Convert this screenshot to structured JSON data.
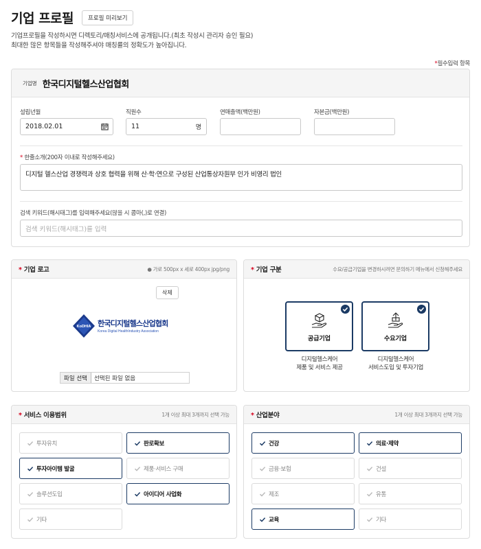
{
  "header": {
    "title": "기업 프로필",
    "preview_button": "프로필 미리보기"
  },
  "description": {
    "line1": "기업프로필을 작성하시면 디렉토리/매칭서비스에 공개됩니다.(최초 작성시 관리자 승인 필요)",
    "line2": "최대한 많은 항목들을 작성해주셔야 매칭률의 정확도가 높아집니다."
  },
  "required_note": "필수입력 항목",
  "profile": {
    "company_label": "기업명",
    "company_name": "한국디지털헬스산업협회",
    "fields": {
      "founded": {
        "label": "설립년월",
        "value": "2018.02.01"
      },
      "employees": {
        "label": "직원수",
        "value": "11",
        "unit": "명"
      },
      "sales": {
        "label": "연매출액(백만원)",
        "value": ""
      },
      "capital": {
        "label": "자본금(백만원)",
        "value": ""
      }
    },
    "intro": {
      "label": "한줄소개(200자 이내로 작성해주세요)",
      "value": "디지털 헬스산업 경쟁력과 상호 협력을 위해 산·학·연으로 구성된 산업통상자원부 인가 비영리 법인"
    },
    "keywords": {
      "label": "검색 키워드(해시태그)를 입력해주세요(많을 시 콤마(,)로 연결)",
      "placeholder": "검색 키워드(해시태그)를 입력"
    }
  },
  "logo_section": {
    "title": "기업 로고",
    "hint": "가로 500px x 세로 400px jpg/png",
    "delete_button": "삭제",
    "logo": {
      "name": "한국디지털헬스산업협회",
      "name_en": "Korea Digital HealthIndustry Association",
      "mark": "KoDHIA"
    },
    "file_button": "파일 선택",
    "file_status": "선택된 파일 없음"
  },
  "type_section": {
    "title": "기업 구분",
    "hint": "수요/공급기업을 변경하시려면 문의하기 메뉴에서 신청해주세요",
    "options": [
      {
        "label": "공급기업",
        "desc1": "디지털헬스케어",
        "desc2": "제품 및 서비스 제공",
        "icon": "supply-box-hand-icon",
        "checked": true
      },
      {
        "label": "수요기업",
        "desc1": "디지털헬스케어",
        "desc2": "서비스도입 및 투자기업",
        "icon": "demand-box-hand-icon",
        "checked": true
      }
    ]
  },
  "service_section": {
    "title": "서비스 이용범위",
    "hint": "1개 이상 최대 3개까지 선택 가능",
    "options": [
      {
        "label": "투자유치",
        "selected": false
      },
      {
        "label": "판로확보",
        "selected": true
      },
      {
        "label": "투자아이템 발굴",
        "selected": true
      },
      {
        "label": "제품·서비스 구매",
        "selected": false
      },
      {
        "label": "솔루션도입",
        "selected": false
      },
      {
        "label": "아이디어 사업화",
        "selected": true
      },
      {
        "label": "기타",
        "selected": false
      }
    ]
  },
  "industry_section": {
    "title": "산업분야",
    "hint": "1개 이상 최대 3개까지 선택 가능",
    "options": [
      {
        "label": "건강",
        "selected": true
      },
      {
        "label": "의료·제약",
        "selected": true
      },
      {
        "label": "금융·보험",
        "selected": false
      },
      {
        "label": "건설",
        "selected": false
      },
      {
        "label": "제조",
        "selected": false
      },
      {
        "label": "유통",
        "selected": false
      },
      {
        "label": "교육",
        "selected": true
      },
      {
        "label": "기타",
        "selected": false
      }
    ]
  },
  "colors": {
    "accent": "#1b3a64",
    "required": "#d6001c",
    "border": "#c8c8c8"
  }
}
